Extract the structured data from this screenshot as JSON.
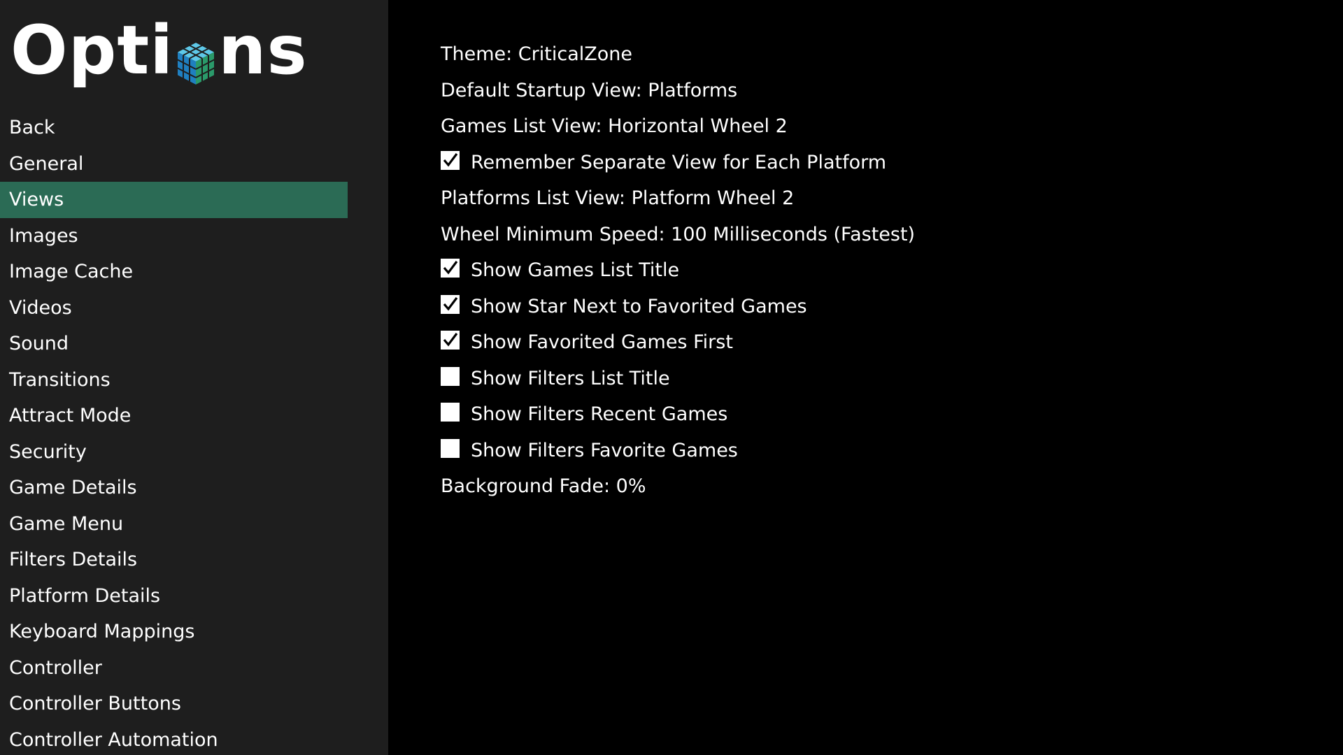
{
  "logo": {
    "text_before": "Opti",
    "text_after": "ns",
    "icon": "cube-icon"
  },
  "sidebar": {
    "items": [
      {
        "label": "Back",
        "selected": false
      },
      {
        "label": "General",
        "selected": false
      },
      {
        "label": "Views",
        "selected": true
      },
      {
        "label": "Images",
        "selected": false
      },
      {
        "label": "Image Cache",
        "selected": false
      },
      {
        "label": "Videos",
        "selected": false
      },
      {
        "label": "Sound",
        "selected": false
      },
      {
        "label": "Transitions",
        "selected": false
      },
      {
        "label": "Attract Mode",
        "selected": false
      },
      {
        "label": "Security",
        "selected": false
      },
      {
        "label": "Game Details",
        "selected": false
      },
      {
        "label": "Game Menu",
        "selected": false
      },
      {
        "label": "Filters Details",
        "selected": false
      },
      {
        "label": "Platform Details",
        "selected": false
      },
      {
        "label": "Keyboard Mappings",
        "selected": false
      },
      {
        "label": "Controller",
        "selected": false
      },
      {
        "label": "Controller Buttons",
        "selected": false
      },
      {
        "label": "Controller Automation",
        "selected": false
      }
    ]
  },
  "options": [
    {
      "label": "Theme: CriticalZone",
      "type": "value"
    },
    {
      "label": "Default Startup View: Platforms",
      "type": "value"
    },
    {
      "label": "Games List View: Horizontal Wheel 2",
      "type": "value"
    },
    {
      "label": "Remember Separate View for Each Platform",
      "type": "checkbox",
      "checked": true
    },
    {
      "label": "Platforms List View: Platform Wheel 2",
      "type": "value"
    },
    {
      "label": "Wheel Minimum Speed: 100 Milliseconds (Fastest)",
      "type": "value"
    },
    {
      "label": "Show Games List Title",
      "type": "checkbox",
      "checked": true
    },
    {
      "label": "Show Star Next to Favorited Games",
      "type": "checkbox",
      "checked": true
    },
    {
      "label": "Show Favorited Games First",
      "type": "checkbox",
      "checked": true
    },
    {
      "label": "Show Filters List Title",
      "type": "checkbox",
      "checked": false
    },
    {
      "label": "Show Filters Recent Games",
      "type": "checkbox",
      "checked": false
    },
    {
      "label": "Show Filters Favorite Games",
      "type": "checkbox",
      "checked": false
    },
    {
      "label": "Background Fade: 0%",
      "type": "value"
    }
  ],
  "colors": {
    "sidebar_bg": "#1e1e1e",
    "content_bg": "#000000",
    "selected_bg": "#2b6b55",
    "text": "#ffffff"
  }
}
